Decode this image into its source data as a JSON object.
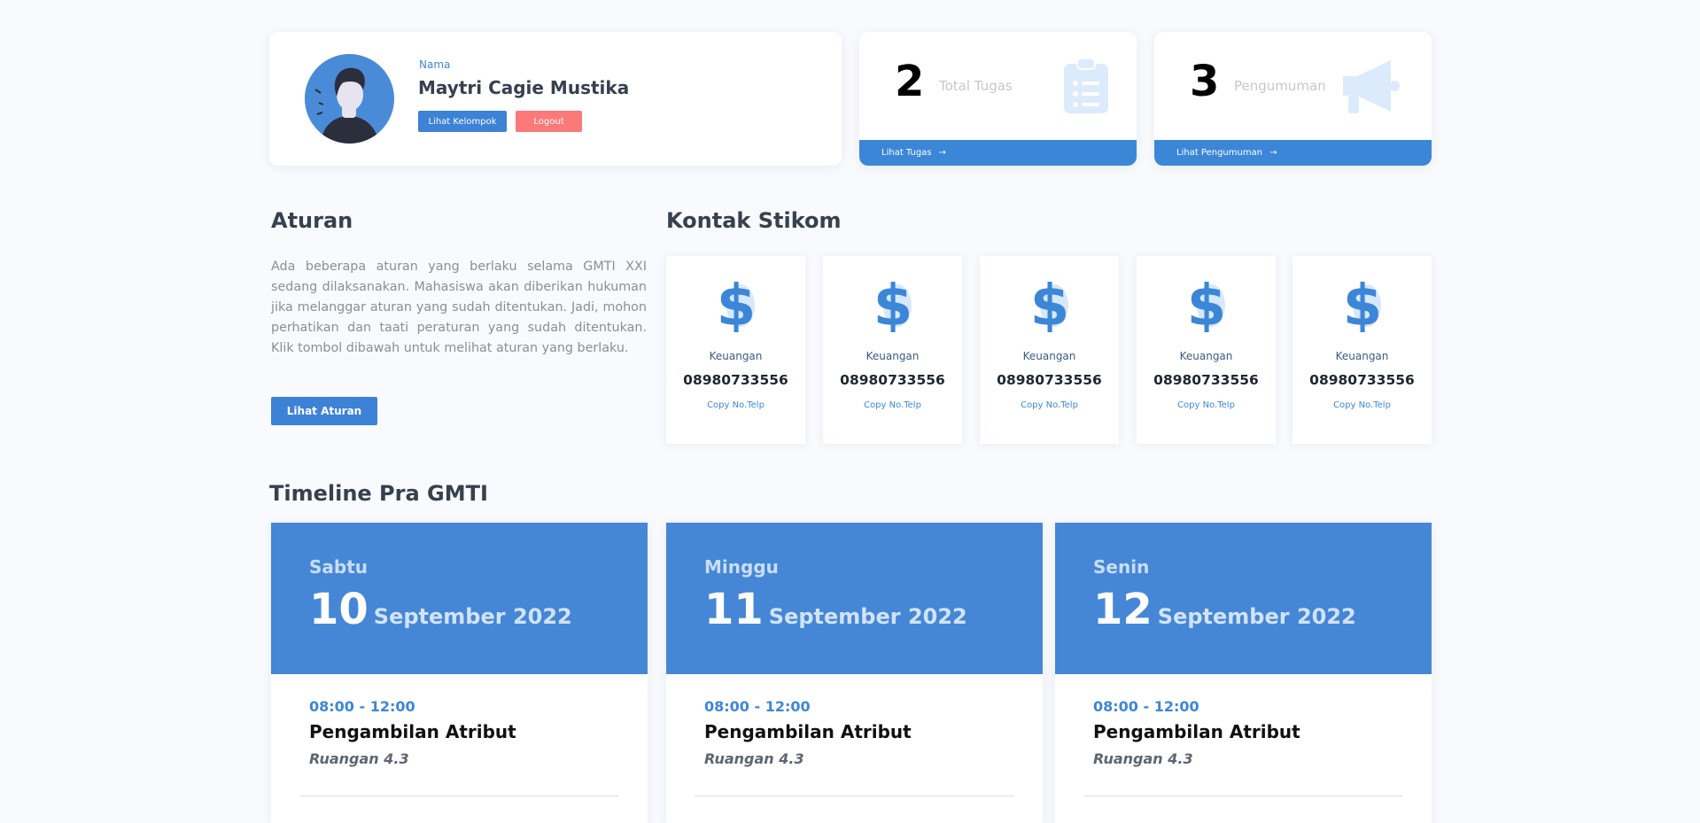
{
  "profile": {
    "name_label": "Nama",
    "name": "Maytri Cagie Mustika",
    "btn_kelompok": "Lihat Kelompok",
    "btn_logout": "Logout"
  },
  "stats": [
    {
      "value": "2",
      "label": "Total Tugas",
      "link": "Lihat Tugas",
      "icon": "clipboard-icon"
    },
    {
      "value": "3",
      "label": "Pengumuman",
      "link": "Lihat Pengumuman",
      "icon": "megaphone-icon"
    }
  ],
  "aturan": {
    "title": "Aturan",
    "text": "Ada beberapa aturan yang berlaku selama GMTI XXI sedang dilaksanakan. Mahasiswa akan diberikan hukuman jika melanggar aturan yang sudah ditentukan. Jadi, mohon perhatikan dan taati peraturan yang sudah ditentukan. Klik tombol dibawah untuk melihat aturan yang berlaku.",
    "button": "Lihat Aturan"
  },
  "kontak": {
    "title": "Kontak Stikom",
    "items": [
      {
        "label": "Keuangan",
        "phone": "08980733556",
        "copy": "Copy No.Telp"
      },
      {
        "label": "Keuangan",
        "phone": "08980733556",
        "copy": "Copy No.Telp"
      },
      {
        "label": "Keuangan",
        "phone": "08980733556",
        "copy": "Copy No.Telp"
      },
      {
        "label": "Keuangan",
        "phone": "08980733556",
        "copy": "Copy No.Telp"
      },
      {
        "label": "Keuangan",
        "phone": "08980733556",
        "copy": "Copy No.Telp"
      }
    ]
  },
  "timeline": {
    "title": "Timeline Pra GMTI",
    "days": [
      {
        "day": "Sabtu",
        "date": "10",
        "month": "September 2022",
        "time": "08:00 - 12:00",
        "event": "Pengambilan Atribut",
        "room": "Ruangan 4.3"
      },
      {
        "day": "Minggu",
        "date": "11",
        "month": "September 2022",
        "time": "08:00 - 12:00",
        "event": "Pengambilan Atribut",
        "room": "Ruangan 4.3"
      },
      {
        "day": "Senin",
        "date": "12",
        "month": "September 2022",
        "time": "08:00 - 12:00",
        "event": "Pengambilan Atribut",
        "room": "Ruangan 4.3"
      }
    ]
  },
  "colors": {
    "primary": "#3c82d6",
    "danger": "#fb7979",
    "icon_faded": "#dcebfb"
  }
}
